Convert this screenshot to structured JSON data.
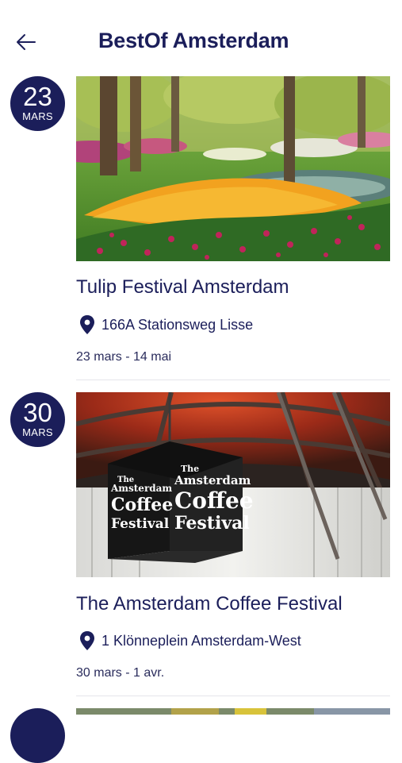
{
  "header": {
    "title": "BestOf Amsterdam",
    "back_icon": "arrow-left-icon"
  },
  "colors": {
    "primary": "#1b1e5a",
    "background": "#ffffff"
  },
  "events": [
    {
      "day": "23",
      "month": "MARS",
      "title": "Tulip Festival Amsterdam",
      "location": "166A Stationsweg Lisse",
      "dates": "23 mars - 14 mai",
      "image": "tulip-garden-photo"
    },
    {
      "day": "30",
      "month": "MARS",
      "title": "The Amsterdam Coffee Festival",
      "location": "1 Klönneplein Amsterdam-West",
      "dates": "30 mars - 1 avr.",
      "image": "coffee-festival-photo",
      "image_text": {
        "line1": "The",
        "line2": "Amsterdam",
        "line3": "Coffee",
        "line4": "Festival"
      }
    }
  ]
}
